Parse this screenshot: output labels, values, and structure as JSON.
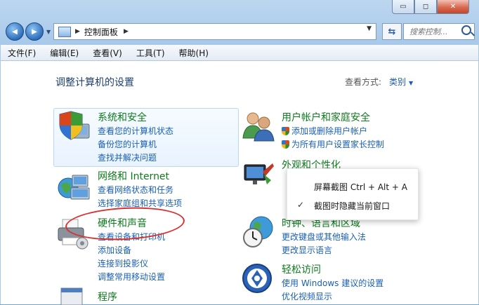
{
  "window": {
    "caption": {
      "minimize": "▭",
      "maximize": "◻",
      "close": "✕"
    }
  },
  "nav": {
    "back": "◀",
    "forward": "▶",
    "address_crumb": "控制面板",
    "search_placeholder": "搜索控制..."
  },
  "menu": [
    "文件(F)",
    "编辑(E)",
    "查看(V)",
    "工具(T)",
    "帮助(H)"
  ],
  "content": {
    "heading": "调整计算机的设置",
    "view_by_label": "查看方式:",
    "view_by_value": "类别"
  },
  "categories": {
    "security": {
      "title": "系统和安全",
      "links": [
        "查看您的计算机状态",
        "备份您的计算机",
        "查找并解决问题"
      ]
    },
    "network": {
      "title": "网络和 Internet",
      "links": [
        "查看网络状态和任务",
        "选择家庭组和共享选项"
      ]
    },
    "hardware": {
      "title": "硬件和声音",
      "links": [
        "查看设备和打印机",
        "添加设备",
        "连接到投影仪",
        "调整常用移动设置"
      ]
    },
    "programs": {
      "title": "程序"
    },
    "users": {
      "title": "用户帐户和家庭安全",
      "links": [
        "添加或删除用户帐户",
        "为所有用户设置家长控制"
      ]
    },
    "appearance": {
      "title": "外观和个性化"
    },
    "clock": {
      "title": "时钟、语言和区域",
      "links": [
        "更改键盘或其他输入法",
        "更改显示语言"
      ]
    },
    "ease": {
      "title": "轻松访问",
      "links": [
        "使用 Windows 建议的设置",
        "优化视频显示"
      ]
    }
  },
  "popup": {
    "item1": "屏幕截图 Ctrl + Alt + A",
    "item2": "截图时隐藏当前窗口",
    "item2_checked": true
  },
  "colors": {
    "category_title": "#0e7a1d",
    "link": "#1a5fb4",
    "annotation": "#d9302f"
  }
}
